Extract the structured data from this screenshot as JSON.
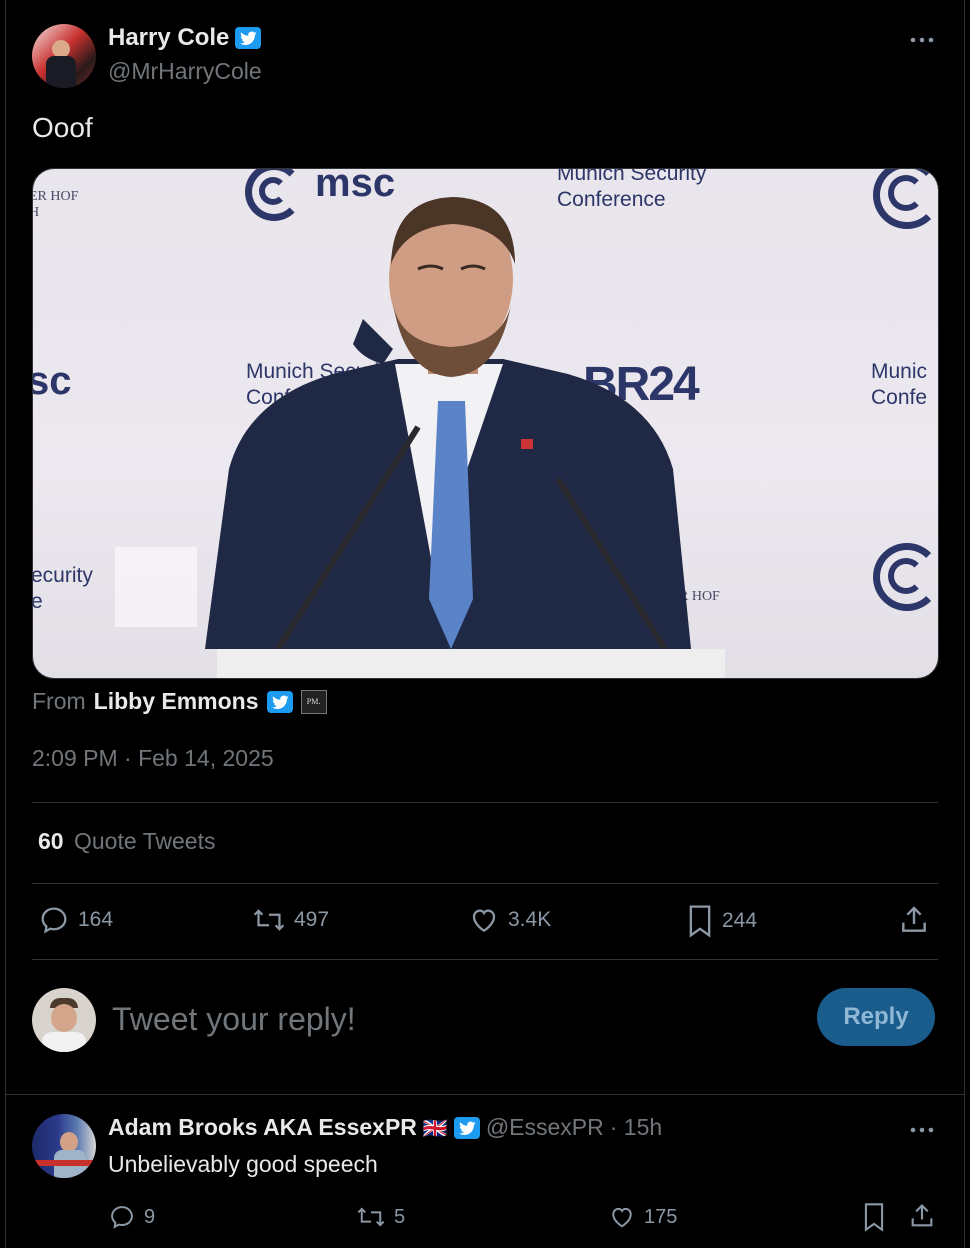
{
  "tweet": {
    "author_name": "Harry Cole",
    "author_handle": "@MrHarryCole",
    "text": "Ooof",
    "media": {
      "backdrop_texts": [
        "msc",
        "Munich Security Conference",
        "Munich Securi",
        "Conferen",
        "BR24",
        "Munic",
        "Confe",
        "ecurity",
        "e",
        "sc",
        "ER HOF",
        "H",
        "R HOF"
      ]
    },
    "source_prefix": "From",
    "source_name": "Libby Emmons",
    "source_badge": "PM.",
    "timestamp": "2:09 PM · Feb 14, 2025",
    "quote_count": "60",
    "quote_label": "Quote Tweets",
    "stats": {
      "replies": "164",
      "retweets": "497",
      "likes": "3.4K",
      "bookmarks": "244"
    }
  },
  "composer": {
    "placeholder": "Tweet your reply!",
    "button_label": "Reply"
  },
  "reply": {
    "author_name": "Adam Brooks AKA EssexPR",
    "flag": "🇬🇧",
    "author_handle": "@EssexPR",
    "age": "· 15h",
    "text": "Unbelievably good speech",
    "stats": {
      "replies": "9",
      "retweets": "5",
      "likes": "175"
    }
  },
  "colors": {
    "accent": "#1d9bf0",
    "background": "#000000",
    "muted": "#71767b",
    "reply_button": "#1a5c8c"
  }
}
